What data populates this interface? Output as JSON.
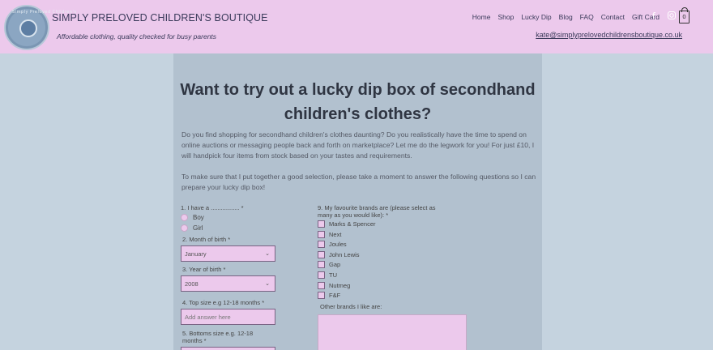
{
  "header": {
    "site_title": "SIMPLY PRELOVED CHILDREN'S BOUTIQUE",
    "tagline": "Affordable clothing, quality checked for busy parents",
    "logo_text": "Simply Preloved Children's",
    "email": "kate@simplyprelovedchildrensboutique.co.uk",
    "cart_count": "0",
    "nav": [
      "Home",
      "Shop",
      "Lucky Dip",
      "Blog",
      "FAQ",
      "Contact",
      "Gift Card"
    ],
    "social_icons": [
      "facebook-icon",
      "instagram-icon"
    ]
  },
  "main": {
    "headline": "Want to try out a lucky dip box of secondhand children's clothes?",
    "intro_1": "Do you find shopping for secondhand children's clothes daunting?  Do you realistically have the time to spend on online auctions or messaging people back and forth on marketplace? Let me do the legwork for you!  For just £10, I will handpick four items from stock based on your tastes and requirements.",
    "intro_2": "To make sure that I put together a good selection, please take a moment to answer the following questions so I can prepare your lucky dip box!"
  },
  "form": {
    "q1": "1. I have a ................. *",
    "q1_options": [
      "Boy",
      "Girl"
    ],
    "q2": "2. Month of birth *",
    "month_value": "January",
    "q3": "3. Year of birth *",
    "year_value": "2008",
    "q4": "4. Top size e.g 12-18 months *",
    "top_size_placeholder": "Add answer here",
    "q5": "5. Bottoms size e.g. 12-18 months *",
    "q9": "9. My favourite brands are (please select as many as you would like): *",
    "brands": [
      "Marks & Spencer",
      "Next",
      "Joules",
      "John Lewis",
      "Gap",
      "TU",
      "Nutmeg",
      "F&F"
    ],
    "other_brands_label": "Other brands I like are:"
  },
  "colors": {
    "header_bg": "#ecc9ec",
    "page_bg": "#c5d3df",
    "panel_bg": "#b2c1cf",
    "field_border": "#7a6384"
  }
}
